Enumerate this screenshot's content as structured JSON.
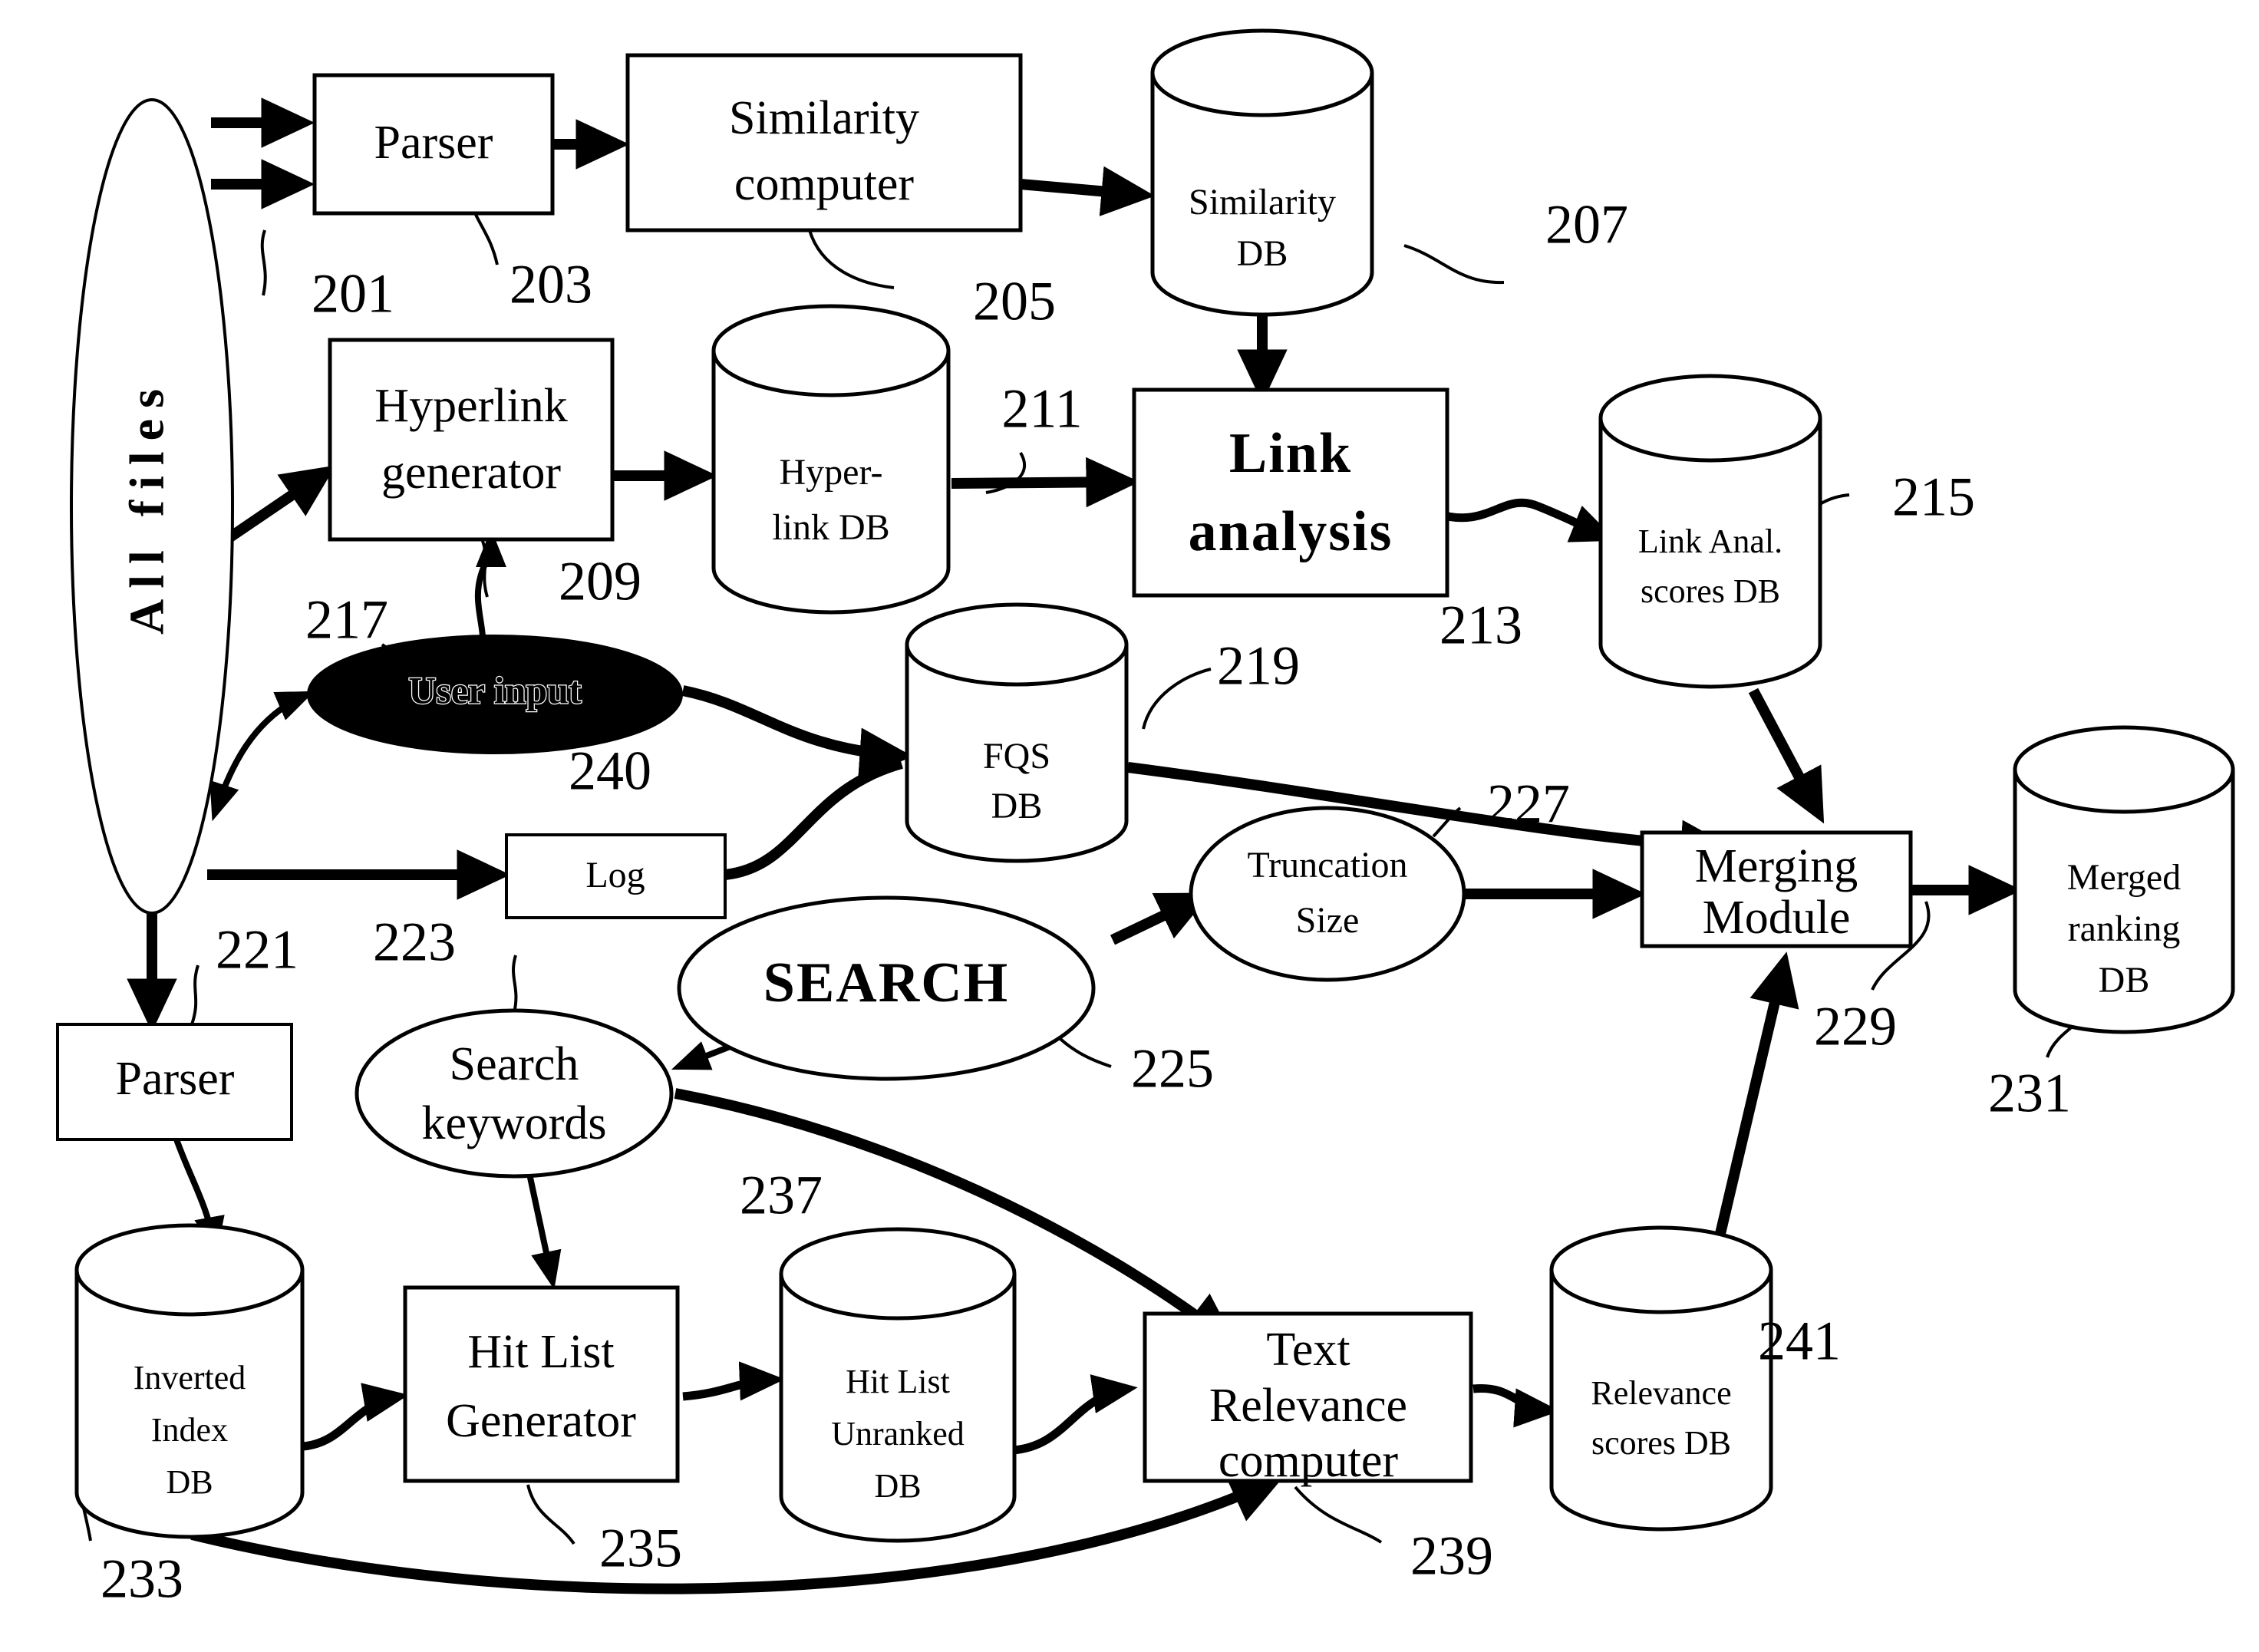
{
  "figure": {
    "title": "Search engine architecture block diagram",
    "background": "#ffffff",
    "ink": "#000000"
  },
  "nodes": {
    "all_files": {
      "label": "All files",
      "shape": "ellipse-vertical"
    },
    "parser_top": {
      "label": "Parser",
      "shape": "rect",
      "ref": "203"
    },
    "similarity_computer": {
      "label_line1": "Similarity",
      "label_line2": "computer",
      "shape": "rect",
      "ref": "205"
    },
    "similarity_db": {
      "label_line1": "Similarity",
      "label_line2": "DB",
      "shape": "cylinder",
      "ref": "207"
    },
    "hyperlink_generator": {
      "label_line1": "Hyperlink",
      "label_line2": "generator",
      "shape": "rect",
      "ref": "209"
    },
    "hyperlink_db": {
      "label_line1": "Hyper-",
      "label_line2": "link DB",
      "shape": "cylinder",
      "ref": "211"
    },
    "link_analysis": {
      "label_line1": "Link",
      "label_line2": "analysis",
      "shape": "rect",
      "ref": "213"
    },
    "link_anal_scores_db": {
      "label_line1": "Link Anal.",
      "label_line2": "scores DB",
      "shape": "cylinder",
      "ref": "215"
    },
    "user_input": {
      "label": "User input",
      "shape": "ellipse-filled",
      "ref": "217"
    },
    "log": {
      "label": "Log",
      "shape": "rect",
      "ref": "240"
    },
    "fqs_db": {
      "label_line1": "FQS",
      "label_line2": "DB",
      "shape": "cylinder",
      "ref": "219"
    },
    "truncation_size": {
      "label_line1": "Truncation",
      "label_line2": "Size",
      "shape": "ellipse",
      "ref": "227"
    },
    "search": {
      "label": "SEARCH",
      "shape": "ellipse",
      "ref": "225"
    },
    "search_keywords": {
      "label_line1": "Search",
      "label_line2": "keywords",
      "shape": "ellipse",
      "ref": "223"
    },
    "merging_module": {
      "label_line1": "Merging",
      "label_line2": "Module",
      "shape": "rect",
      "ref": "229"
    },
    "merged_ranking_db": {
      "label_line1": "Merged",
      "label_line2": "ranking",
      "label_line3": "DB",
      "shape": "cylinder",
      "ref": "231"
    },
    "parser_bottom": {
      "label": "Parser",
      "shape": "rect",
      "ref": "221"
    },
    "inverted_index_db": {
      "label_line1": "Inverted",
      "label_line2": "Index",
      "label_line3": "DB",
      "shape": "cylinder",
      "ref": "233"
    },
    "hit_list_generator": {
      "label_line1": "Hit List",
      "label_line2": "Generator",
      "shape": "rect",
      "ref": "235"
    },
    "hit_list_unranked_db": {
      "label_line1": "Hit List",
      "label_line2": "Unranked",
      "label_line3": "DB",
      "shape": "cylinder",
      "ref": "237"
    },
    "text_relevance_computer": {
      "label_line1": "Text",
      "label_line2": "Relevance",
      "label_line3": "computer",
      "shape": "rect",
      "ref": "239"
    },
    "relevance_scores_db": {
      "label_line1": "Relevance",
      "label_line2": "scores DB",
      "shape": "cylinder",
      "ref": "241"
    }
  },
  "reference_numerals": {
    "n201": "201",
    "n203": "203",
    "n205": "205",
    "n207": "207",
    "n209": "209",
    "n211": "211",
    "n213": "213",
    "n215": "215",
    "n217": "217",
    "n219": "219",
    "n221": "221",
    "n223": "223",
    "n225": "225",
    "n227": "227",
    "n229": "229",
    "n231": "231",
    "n233": "233",
    "n235": "235",
    "n237": "237",
    "n239": "239",
    "n240": "240",
    "n241": "241"
  }
}
